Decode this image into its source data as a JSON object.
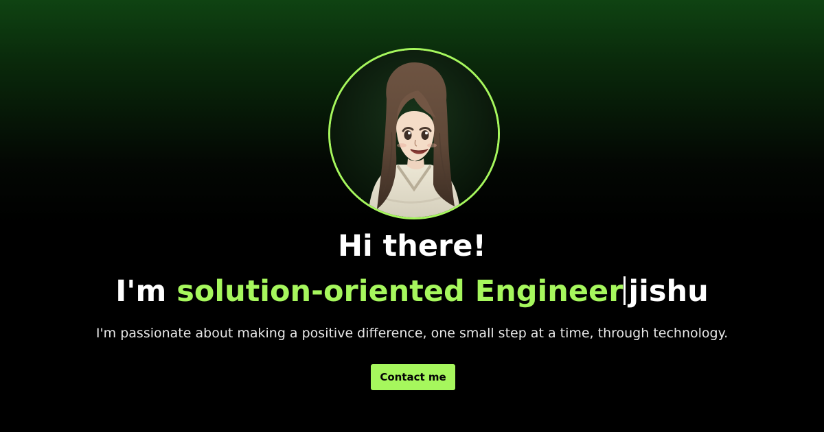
{
  "hero": {
    "greeting": "Hi there!",
    "intro_prefix": "I'm ",
    "role_text": "solution-oriented Engineer",
    "name": "jishu",
    "tagline": "I'm passionate about making a positive difference, one small step at a time, through technology.",
    "contact_label": "Contact me"
  },
  "colors": {
    "accent": "#a6f75d",
    "background_top": "#0f4312",
    "background_bottom": "#000000",
    "text": "#ffffff"
  }
}
